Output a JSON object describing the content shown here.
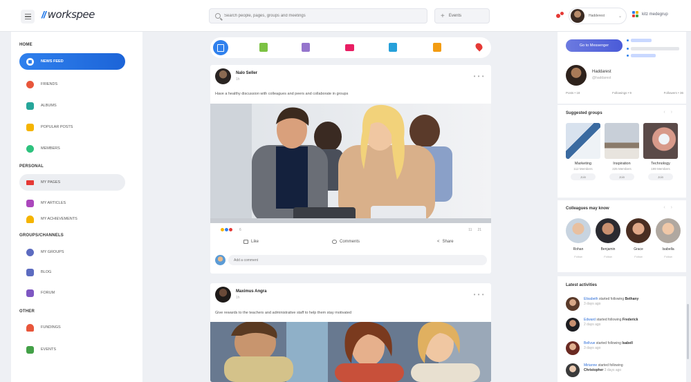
{
  "app": {
    "logo_mark": "//",
    "logo_text": "workspee",
    "company_name": "kitz medegrup"
  },
  "search": {
    "placeholder": "Search people, pages, groups and meetings",
    "filter_label": "Events"
  },
  "user": {
    "name": "Hadderest"
  },
  "sidebar": {
    "sections": [
      {
        "title": "HOME",
        "items": [
          {
            "label": "NEWS FEED",
            "icon": "news-icon",
            "color": "#2f80ed",
            "active": "blue"
          },
          {
            "label": "FRIENDS",
            "icon": "friends-icon",
            "color": "#e8563b"
          },
          {
            "label": "ALBUMS",
            "icon": "albums-icon",
            "color": "#26a69a"
          },
          {
            "label": "POPULAR POSTS",
            "icon": "popular-icon",
            "color": "#f5b400"
          },
          {
            "label": "MEMBERS",
            "icon": "members-icon",
            "color": "#2ec27e"
          }
        ]
      },
      {
        "title": "PERSONAL",
        "items": [
          {
            "label": "MY PAGES",
            "icon": "flag-icon",
            "color": "#e53935",
            "active": "gray"
          },
          {
            "label": "MY ARTICLES",
            "icon": "articles-icon",
            "color": "#ab47bc"
          },
          {
            "label": "MY ACHIEVEMENTS",
            "icon": "trophy-icon",
            "color": "#f5b400"
          }
        ]
      },
      {
        "title": "GROUPS/CHANNELS",
        "items": [
          {
            "label": "MY GROUPS",
            "icon": "groups-icon",
            "color": "#5c6bc0"
          },
          {
            "label": "BLOG",
            "icon": "blog-icon",
            "color": "#5c6bc0"
          },
          {
            "label": "FORUM",
            "icon": "forum-icon",
            "color": "#7e57c2"
          }
        ]
      },
      {
        "title": "OTHER",
        "items": [
          {
            "label": "FUNDINGS",
            "icon": "fundings-icon",
            "color": "#e8563b"
          },
          {
            "label": "EVENTS",
            "icon": "events-icon",
            "color": "#43a047"
          }
        ]
      }
    ]
  },
  "quickbar": {
    "icons": [
      {
        "name": "post-icon",
        "color": "#2f80ed"
      },
      {
        "name": "article-icon",
        "color": "#7cc243"
      },
      {
        "name": "photo-icon",
        "color": "#9575cd"
      },
      {
        "name": "video-icon",
        "color": "#e91e63"
      },
      {
        "name": "live-icon",
        "color": "#26a0da"
      },
      {
        "name": "event-icon",
        "color": "#f39c12"
      },
      {
        "name": "location-icon",
        "color": "#e53935"
      }
    ]
  },
  "posts": [
    {
      "author": "Nalo Seller",
      "time": "1h",
      "text": "Have a healthy discussion with colleagues and peers and collaborate in groups",
      "reaction_count": "6",
      "comments_count": "11",
      "shares_count": "21",
      "like_label": "Like",
      "comment_label": "Comments",
      "share_label": "Share",
      "comment_placeholder": "Add a comment"
    },
    {
      "author": "Maximus Angra",
      "time": "1h",
      "text": "Give rewards to the teachers and administrative staff to help them stay motivated"
    }
  ],
  "right": {
    "messenger_label": "Go to Messenger",
    "profile": {
      "name": "Haddarest",
      "handle": "@haddarest"
    },
    "stats": [
      "Posts • 18",
      "Followings • 9",
      "Followers • 36"
    ],
    "suggested_title": "Suggested groups",
    "groups": [
      {
        "name": "Marketing",
        "members": "112 Members",
        "join": "Join"
      },
      {
        "name": "Inspiration",
        "members": "225 Members",
        "join": "Join"
      },
      {
        "name": "Technology",
        "members": "199 Members",
        "join": "Join"
      }
    ],
    "colleagues_title": "Colleagues may know",
    "people": [
      {
        "name": "Rohan",
        "role": "Follow"
      },
      {
        "name": "Benjamin",
        "role": "Follow"
      },
      {
        "name": "Grace",
        "role": "Follow"
      },
      {
        "name": "Isabella",
        "role": "Follow"
      }
    ],
    "activities_title": "Latest activities",
    "activities": [
      {
        "who": "Elisabeth",
        "what": "started following",
        "whom": "Bethany",
        "ago": "3 days ago"
      },
      {
        "who": "Edward",
        "what": "started following",
        "whom": "Frederick",
        "ago": "2 days ago"
      },
      {
        "who": "Bellvue",
        "what": "started following",
        "whom": "Isabell",
        "ago": "3 days ago"
      },
      {
        "who": "Mirianne",
        "what": "started following",
        "whom": "Christopher",
        "ago": "3 days ago"
      }
    ]
  }
}
